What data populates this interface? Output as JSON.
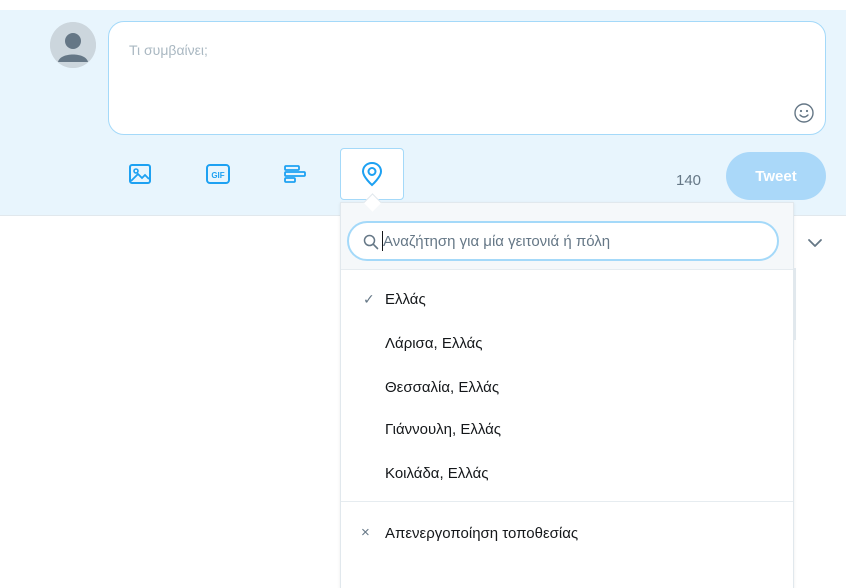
{
  "composer": {
    "placeholder": "Τι συμβαίνει;",
    "char_count": "140",
    "tweet_label": "Tweet",
    "tools": [
      "image-icon",
      "gif-icon",
      "poll-icon",
      "location-icon"
    ]
  },
  "location_dropdown": {
    "search_placeholder": "Αναζήτηση για μία γειτονιά ή πόλη",
    "selected_mark": "✓",
    "items": [
      {
        "label": "Ελλάς",
        "selected": true
      },
      {
        "label": "Λάρισα, Ελλάς",
        "selected": false
      },
      {
        "label": "Θεσσαλία, Ελλάς",
        "selected": false
      },
      {
        "label": "Γιάννουλη, Ελλάς",
        "selected": false
      },
      {
        "label": "Κοιλάδα, Ελλάς",
        "selected": false
      }
    ],
    "disable_mark": "×",
    "disable_label": "Απενεργοποίηση τοποθεσίας"
  },
  "colors": {
    "band": "#e8f5fd",
    "accent": "#1da1f2",
    "tweet_button_disabled": "#aad8f9",
    "border": "#a4d9f9"
  }
}
